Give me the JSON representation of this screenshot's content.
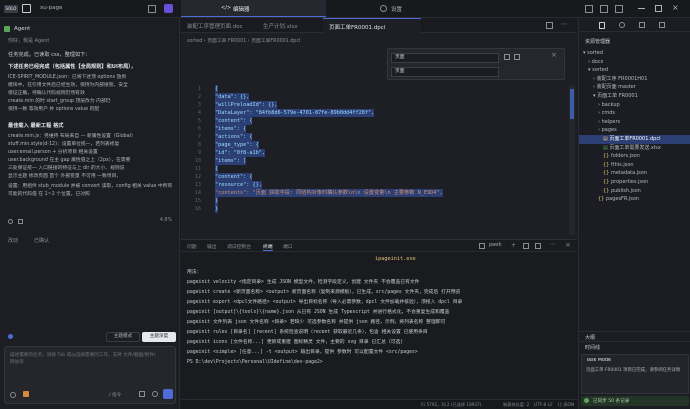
{
  "topbar": {
    "brand": "SOLO",
    "project": "xu-page",
    "center_tab_editor": "编辑器",
    "center_tab_settings": "设置"
  },
  "left": {
    "agent_label": "Agent",
    "greeting": "你好，我是 Agent",
    "heading1": "任务完成。已读取 css，整理如下：",
    "section1": "下述任务已经完成（包括属性【全局规则】和UI布局），",
    "bullets1": [
      "ICE-SPIRIT_MODULE.json：已将下述顶 options 放到",
      "模块中，在引用文件后已经生效，保持为内部接管，安全",
      "保证正确，待确认代码规则仍然有效",
      "create.min 的时 start_group 顶层改为 内部仍",
      "保持一致 等效用户 并 options value 的配"
    ],
    "heading2": "最佳载入 最新工程 格式",
    "bullets2": [
      "create.min.js：另维持 布局来自 — 新属性设置（Global）",
      "stuff.min.style(d-12)：设置单位统一，若列表修复",
      "user.email.person + 分析项目 相关设置",
      "user.background 在主 gap 属性值之上（2px），在需要",
      "三处保证统一 入口链接的特征与上 dir 的大小、规则说",
      "显示主题 修改页面 首个 外部变量 不可用 一致项目，"
    ],
    "note": "设置：用组件 stub_module 并被 convert 读取，config 相关 value 中所有 可能的代码值 在 1~2 个位置，已对照",
    "footer_links": [
      "改动",
      "已确认"
    ],
    "progress": "4.8%",
    "mode_left": "主题模式",
    "mode_right": "主题深度",
    "prompt_placeholder": "描述需要的任务，请按 Tab 或@选择需要的工作，支持 文件/截图/附件/网站等",
    "prompt_hint": "/ 指令"
  },
  "editor": {
    "tabs": [
      "装配工序管理页面.doc",
      "生产计划.xlsx",
      "页面工单FR0001.dpcl"
    ],
    "breadcrumb": "sorted › 页面工单 FR0001 › 页面工单FR0001.dpcl",
    "search_value": "页面",
    "replace_value": "页面",
    "lines": [
      {
        "n": "1",
        "t": "{"
      },
      {
        "n": "2",
        "t": "  \"data\": {},"
      },
      {
        "n": "3",
        "t": "  \"willPreloadId\": {},"
      },
      {
        "n": "4",
        "t": "  \"DataLayer\": \"84fb8d6-579e-4701-87fe-89b0dd4ff28f\","
      },
      {
        "n": "5",
        "t": "  \"content\": {"
      },
      {
        "n": "6",
        "t": "    \"items\": {"
      },
      {
        "n": "7",
        "t": "      \"actions\": {"
      },
      {
        "n": "8",
        "t": "        \"page_type\": {"
      },
      {
        "n": "9",
        "t": "          \"id\": \"0f8-a1b\","
      },
      {
        "n": "10",
        "t": "          \"items\": ["
      },
      {
        "n": "11",
        "t": "            {"
      },
      {
        "n": "12",
        "t": "              \"content\": {"
      },
      {
        "n": "13",
        "t": "                \"resource\": {},"
      },
      {
        "n": "14",
        "t": "                \"contents\": \"页面 获取字段: 同结构对象时确认参数\\n\\n 设置变量\\n 主要参数 N_E9D4\","
      },
      {
        "n": "15",
        "t": "              }"
      },
      {
        "n": "16",
        "t": "            }"
      }
    ]
  },
  "terminal": {
    "tabs": [
      "问题",
      "输出",
      "调试控制台",
      "终端",
      "端口"
    ],
    "shell_label": "pwsh",
    "title_line": "ipageinit.exe",
    "lines": [
      "用法：",
      "  pageinit velocity <指定目录>              生成 JSON 模型文件，检测字段定义，创建 文件夹 不会覆盖已有文件",
      "  pageinit create <新页面名称> <output> 新页面名称（复制来源模板），已生成，src/pages 文件夹，完成后 打开预览",
      "  pageinit export <dpcl文件路径> <output> 导出目标名称（导入必需参数，dpcl 文件加载并核验），须拖入 dpcl 目录",
      "  pageinit [output]\\{tools}\\{name}.json  从已有 JSON 生成 Typescript 并进行格式化，不会重复生成和覆盖",
      "  pageinit 文件列表 json 文件名称 <目录> 若缺少 可选参数名称 并提供 json 路径，示例，将列表名称 整理即可",
      "  pageinit rules [目录名] [recent]  系统检查说明（recent 获取最近几条），包含 相关设置 已使用条目",
      "  pageinit icons [文件名称...] 更新或重建 图标精灵 文件，主要的 svg 目录 已汇总（可选)",
      "  pageinit <simple> [任意...]  -t <output> 输出目录，提供 参数时 可以配置文件 <src/pages>",
      "PS D:\\dev\\Projects\\Personal\\UIdefine\\dev-page2>"
    ]
  },
  "right": {
    "title": "资源管理器",
    "tree": [
      {
        "label": "sorted",
        "depth": 0,
        "open": true
      },
      {
        "label": "docs",
        "depth": 1,
        "open": false
      },
      {
        "label": "sorted",
        "depth": 1,
        "open": true
      },
      {
        "label": "装配工序 FR0001H01",
        "depth": 2,
        "open": false
      },
      {
        "label": "装配页面 master",
        "depth": 2,
        "open": false
      },
      {
        "label": "页面工单 FR0001",
        "depth": 2,
        "open": true
      },
      {
        "label": "backup",
        "depth": 3,
        "open": false
      },
      {
        "label": "cmds",
        "depth": 3,
        "open": false
      },
      {
        "label": "helpers",
        "depth": 3,
        "open": false
      },
      {
        "label": "pages",
        "depth": 3,
        "open": false
      },
      {
        "label": "页面工单FR0001.dpcl",
        "depth": 3,
        "file": true,
        "active": true
      },
      {
        "label": "页面工单需要发送.xlsx",
        "depth": 3,
        "file": true
      },
      {
        "label": "folders.json",
        "depth": 3,
        "file": true
      },
      {
        "label": "fthis.json",
        "depth": 3,
        "file": true
      },
      {
        "label": "metadata.json",
        "depth": 3,
        "file": true
      },
      {
        "label": "properties.json",
        "depth": 3,
        "file": true
      },
      {
        "label": "publish.json",
        "depth": 3,
        "file": true
      },
      {
        "label": "pagesFR.json",
        "depth": 2,
        "file": true
      }
    ],
    "outline": "大纲",
    "timeline": "时间线",
    "chat_title": "Task Mode",
    "chat_text": "页面工单 FR0001 项目已完成，请参阅任务详情",
    "notice": "已同步 50 条记录"
  },
  "status": {
    "left": "Ln 1, Col 1",
    "items": [
      "行 5792，列 2 (已选择 18937)",
      "制表符长度: 2",
      "UTF-8",
      "LF",
      "{} JSON",
      "CUE"
    ]
  },
  "colors": {
    "selection": "#2c3f74",
    "accent": "#4f6bd6",
    "json_key": "#9cdcfe",
    "json_string": "#ce9178",
    "terminal_title": "#e5c07b",
    "green": "#5aa55a"
  }
}
